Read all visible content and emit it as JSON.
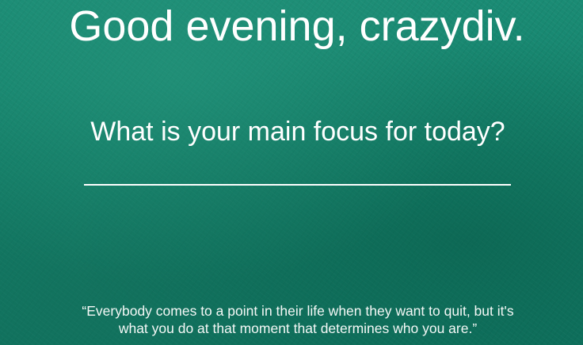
{
  "greeting": {
    "text": "Good evening, crazydiv."
  },
  "focus": {
    "question": "What is your main focus for today?",
    "input_value": "",
    "input_placeholder": ""
  },
  "quote": {
    "text": "“Everybody comes to a point in their life when they want to quit, but it's what you do at that moment that determines who you are.”"
  },
  "colors": {
    "background": "#137c68",
    "text": "#ffffff"
  }
}
